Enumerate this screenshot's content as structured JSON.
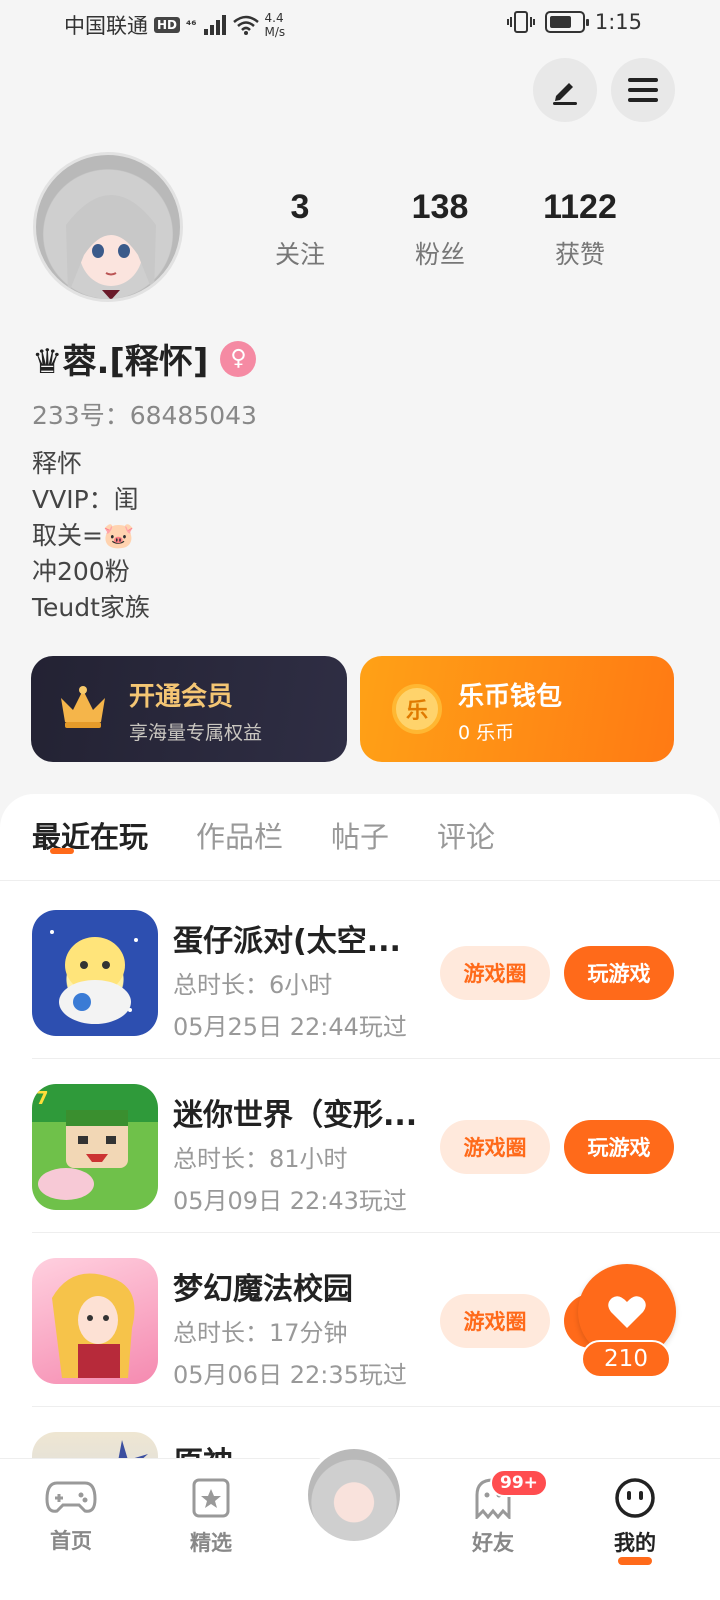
{
  "status_bar": {
    "carrier": "中国联通",
    "hd": "HD",
    "signal": "⁴⁶",
    "speed_value": "4.4",
    "speed_unit": "M/s",
    "time": "1:15"
  },
  "profile": {
    "stats": [
      {
        "value": "3",
        "label": "关注"
      },
      {
        "value": "138",
        "label": "粉丝"
      },
      {
        "value": "1122",
        "label": "获赞"
      }
    ],
    "nickname": "♛蓉.[释怀]",
    "gender_symbol": "♀",
    "uid": "233号：68485043",
    "bio": [
      "释怀",
      "VVIP：闺",
      "取关=🐷",
      "冲200粉",
      "Teudt家族"
    ]
  },
  "cards": {
    "vip": {
      "title": "开通会员",
      "subtitle": "享海量专属权益"
    },
    "wallet": {
      "title": "乐币钱包",
      "subtitle": "0 乐币",
      "coin_glyph": "乐"
    }
  },
  "tabs": [
    {
      "label": "最近在玩",
      "active": true
    },
    {
      "label": "作品栏",
      "active": false
    },
    {
      "label": "帖子",
      "active": false
    },
    {
      "label": "评论",
      "active": false
    }
  ],
  "games": [
    {
      "name": "蛋仔派对(太空...",
      "duration": "总时长：6小时",
      "last_played": "05月25日 22:44玩过",
      "circle_label": "游戏圈",
      "play_label": "玩游戏"
    },
    {
      "name": "迷你世界（变形...",
      "duration": "总时长：81小时",
      "last_played": "05月09日 22:43玩过",
      "circle_label": "游戏圈",
      "play_label": "玩游戏"
    },
    {
      "name": "梦幻魔法校园",
      "duration": "总时长：17分钟",
      "last_played": "05月06日 22:35玩过",
      "circle_label": "游戏圈",
      "play_label": "玩游戏"
    },
    {
      "name": "原神",
      "duration": "",
      "last_played": "",
      "circle_label": "",
      "play_label": ""
    }
  ],
  "floating_like": {
    "count": "210"
  },
  "bottom_nav": {
    "home": "首页",
    "featured": "精选",
    "friends": "好友",
    "friends_badge": "99+",
    "mine": "我的"
  },
  "colors": {
    "accent": "#ff6a1a",
    "vip_card": "#2a2a3c",
    "wallet_card": "#ff8f14"
  }
}
